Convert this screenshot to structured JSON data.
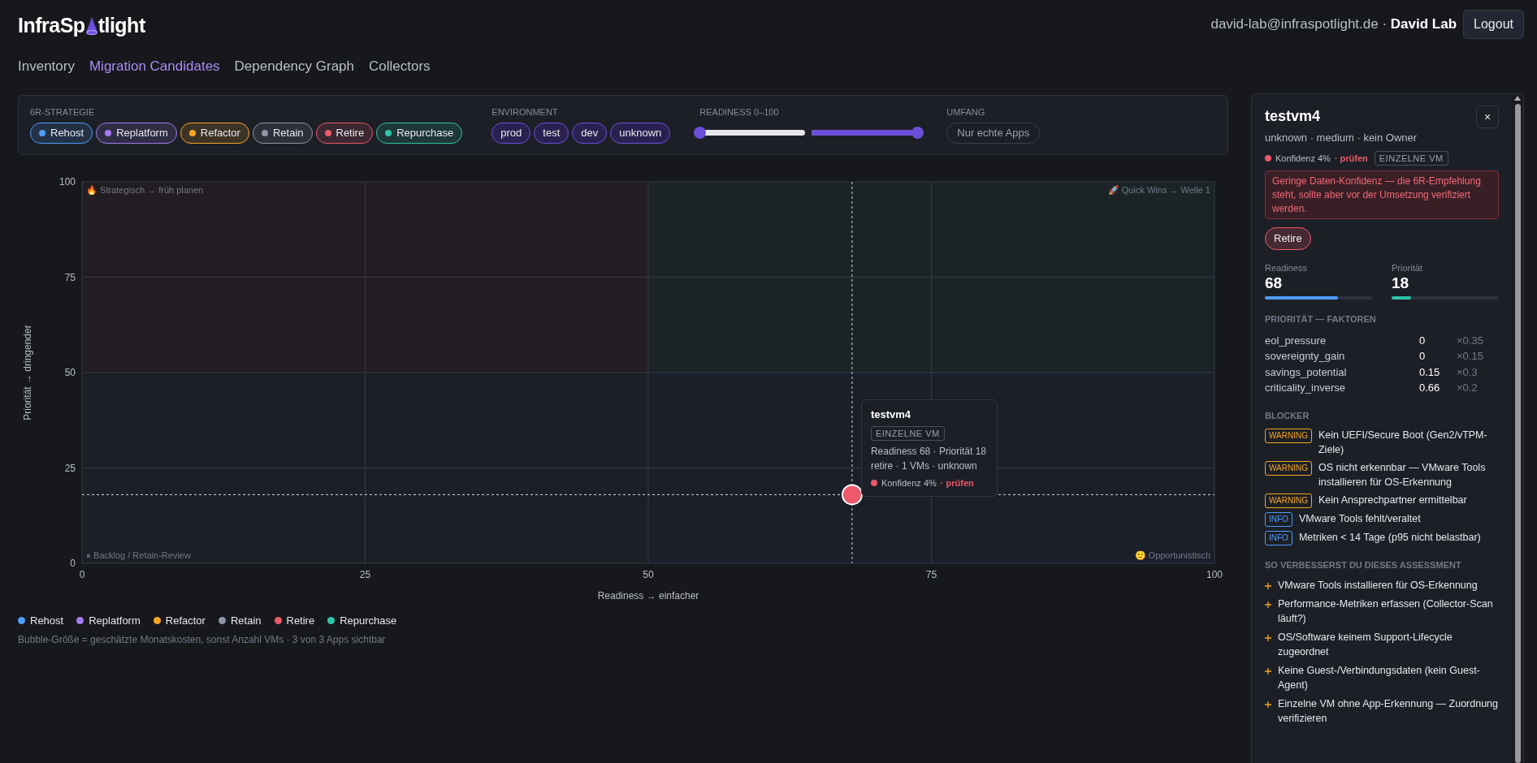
{
  "header": {
    "logo_parts": [
      "InfraSp",
      "tlight"
    ],
    "user_email": "david-lab@infraspotlight.de",
    "separator": "·",
    "user_name": "David Lab",
    "logout": "Logout"
  },
  "nav": [
    {
      "label": "Inventory",
      "selected": false
    },
    {
      "label": "Migration Candidates",
      "selected": true
    },
    {
      "label": "Dependency Graph",
      "selected": false
    },
    {
      "label": "Collectors",
      "selected": false
    }
  ],
  "filters": {
    "strategy": {
      "label": "6R-STRATEGIE",
      "chips": [
        {
          "label": "Rehost",
          "color": "#4f9cf9",
          "selected": true
        },
        {
          "label": "Replatform",
          "color": "#a37cf0",
          "selected": true
        },
        {
          "label": "Refactor",
          "color": "#f5a524",
          "selected": true
        },
        {
          "label": "Retain",
          "color": "#8e96a6",
          "selected": true
        },
        {
          "label": "Retire",
          "color": "#ec5a6b",
          "selected": true
        },
        {
          "label": "Repurchase",
          "color": "#2ec4a9",
          "selected": true
        }
      ]
    },
    "environment": {
      "label": "ENVIRONMENT",
      "chips": [
        {
          "label": "prod",
          "selected": true
        },
        {
          "label": "test",
          "selected": true
        },
        {
          "label": "dev",
          "selected": true
        },
        {
          "label": "unknown",
          "selected": true
        }
      ]
    },
    "readiness": {
      "label": "READINESS 0–100",
      "sliders": [
        {
          "level": 0
        },
        {
          "level": 1
        }
      ]
    },
    "scope": {
      "label": "UMFANG",
      "toggle": {
        "label": "Nur echte Apps",
        "on": false
      }
    }
  },
  "chart": {
    "chart_data": {
      "type": "scatter",
      "xlabel": "Readiness → einfacher",
      "ylabel": "Priorität → dringender",
      "x": [
        68
      ],
      "series": [
        {
          "color": "#ec5a6b",
          "values": [
            18
          ]
        }
      ],
      "xlim": [
        0,
        100
      ],
      "ylim": [
        0,
        100
      ],
      "xticks": [
        0,
        25,
        50,
        75,
        100
      ],
      "yticks": [
        0,
        25,
        50,
        75,
        100
      ],
      "grid": true,
      "ref_lines": [
        {
          "axis": "x",
          "value": 68
        },
        {
          "axis": "y",
          "value": 18
        }
      ],
      "annotations": [
        "🔥 Strategisch → früh planen",
        "🚀 Quick Wins → Welle 1",
        "⏸ Backlog / Retain-Review",
        "🙂 Opportunistisch"
      ]
    },
    "tooltip": {
      "title": "testvm4",
      "badge": "EINZELNE VM",
      "line_1": "Readiness 68 · Priorität 18",
      "line_2": "retire · 1 VMs · unknown",
      "confidence": "Konfidenz 4%",
      "flag": "· prüfen",
      "color": "#ec5a6b"
    }
  },
  "legend": {
    "items": [
      {
        "label": "Rehost",
        "color": "#4f9cf9"
      },
      {
        "label": "Replatform",
        "color": "#a37cf0"
      },
      {
        "label": "Refactor",
        "color": "#f5a524"
      },
      {
        "label": "Retain",
        "color": "#8e96a6"
      },
      {
        "label": "Retire",
        "color": "#ec5a6b"
      },
      {
        "label": "Repurchase",
        "color": "#2ec4a9"
      }
    ],
    "note": "Bubble-Größe = geschätzte Monatskosten, sonst Anzahl VMs · 3 von 3 Apps sichtbar"
  },
  "detail": {
    "title": "testvm4",
    "close": "×",
    "subtitle": "unknown · medium · kein Owner",
    "confidence": {
      "text": "Konfidenz 4%",
      "flag": "· prüfen",
      "color": "#ec5a6b"
    },
    "badge": "EINZELNE VM",
    "alert": "Geringe Daten-Konfidenz — die 6R-Empfehlung steht, sollte aber vor der Umsetzung verifiziert werden.",
    "strategy": {
      "label": "Retire",
      "color": "#ec5a6b"
    },
    "metrics": [
      {
        "label": "Readiness",
        "value": "68",
        "level": 0.68,
        "color": "#4f9cf9"
      },
      {
        "label": "Priorität",
        "value": "18",
        "level": 0.18,
        "color": "#2ec4a9"
      }
    ],
    "factors_title": "PRIORITÄT — FAKTOREN",
    "factors": [
      {
        "name": "eol_pressure",
        "value": "0",
        "weight": "×0.35"
      },
      {
        "name": "sovereignty_gain",
        "value": "0",
        "weight": "×0.15"
      },
      {
        "name": "savings_potential",
        "value": "0.15",
        "weight": "×0.3"
      },
      {
        "name": "criticality_inverse",
        "value": "0.66",
        "weight": "×0.2"
      }
    ],
    "blockers_title": "BLOCKER",
    "blockers": [
      {
        "kind": "warning",
        "label": "WARNING",
        "text": "Kein UEFI/Secure Boot (Gen2/vTPM-Ziele)"
      },
      {
        "kind": "warning",
        "label": "WARNING",
        "text": "OS nicht erkennbar — VMware Tools installieren für OS-Erkennung"
      },
      {
        "kind": "warning",
        "label": "WARNING",
        "text": "Kein Ansprechpartner ermittelbar"
      },
      {
        "kind": "info",
        "label": "INFO",
        "text": "VMware Tools fehlt/veraltet"
      },
      {
        "kind": "info",
        "label": "INFO",
        "text": "Metriken < 14 Tage (p95 nicht belastbar)"
      }
    ],
    "improvements_title": "SO VERBESSERST DU DIESES ASSESSMENT",
    "improvements": [
      "VMware Tools installieren für OS-Erkennung",
      "Performance-Metriken erfassen (Collector-Scan läuft?)",
      "OS/Software keinem Support-Lifecycle zugeordnet",
      "Keine Guest-/Verbindungsdaten (kein Guest-Agent)",
      "Einzelne VM ohne App-Erkennung — Zuordnung verifizieren"
    ]
  }
}
